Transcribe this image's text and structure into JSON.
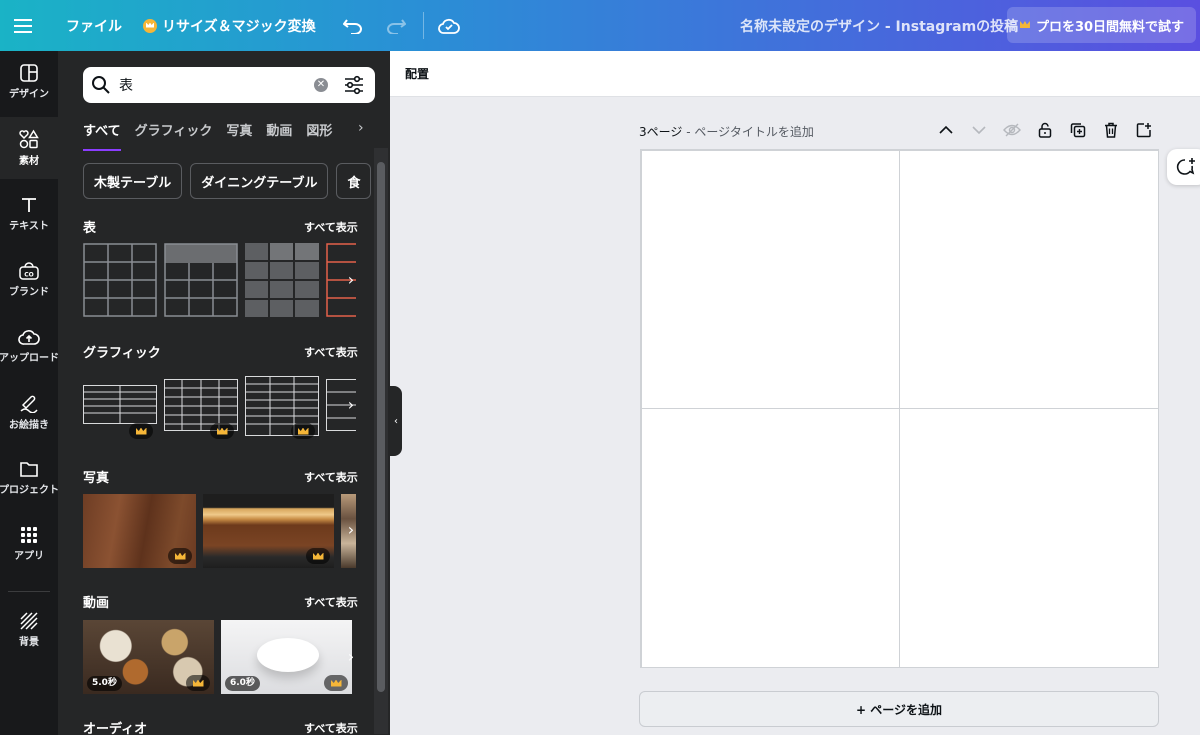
{
  "topbar": {
    "file_label": "ファイル",
    "resize_label": "リサイズ＆マジック変換",
    "doc_title": "名称未設定のデザイン - Instagramの投稿",
    "trial_label": "プロを30日間無料で試す"
  },
  "nav": {
    "items": [
      {
        "label": "デザイン",
        "icon": "design-icon"
      },
      {
        "label": "素材",
        "icon": "elements-icon"
      },
      {
        "label": "テキスト",
        "icon": "text-icon"
      },
      {
        "label": "ブランド",
        "icon": "brand-icon"
      },
      {
        "label": "アップロード",
        "icon": "upload-icon"
      },
      {
        "label": "お絵描き",
        "icon": "draw-icon"
      },
      {
        "label": "プロジェクト",
        "icon": "folder-icon"
      },
      {
        "label": "アプリ",
        "icon": "apps-icon"
      },
      {
        "label": "背景",
        "icon": "background-icon"
      }
    ],
    "active": "素材"
  },
  "panel": {
    "search_value": "表",
    "categories": [
      "すべて",
      "グラフィック",
      "写真",
      "動画",
      "図形"
    ],
    "chips": [
      "木製テーブル",
      "ダイニングテーブル",
      "食"
    ],
    "sections": [
      {
        "title": "表",
        "see_all": "すべて表示"
      },
      {
        "title": "グラフィック",
        "see_all": "すべて表示"
      },
      {
        "title": "写真",
        "see_all": "すべて表示"
      },
      {
        "title": "動画",
        "see_all": "すべて表示"
      },
      {
        "title": "オーディオ",
        "see_all": "すべて表示"
      }
    ],
    "videos": [
      {
        "duration": "5.0秒"
      },
      {
        "duration": "6.0秒"
      }
    ]
  },
  "editor": {
    "toolbar_label": "配置",
    "page_number": "3ページ",
    "page_title_placeholder": " - ページタイトルを追加",
    "add_page_label": "+ ページを追加"
  }
}
